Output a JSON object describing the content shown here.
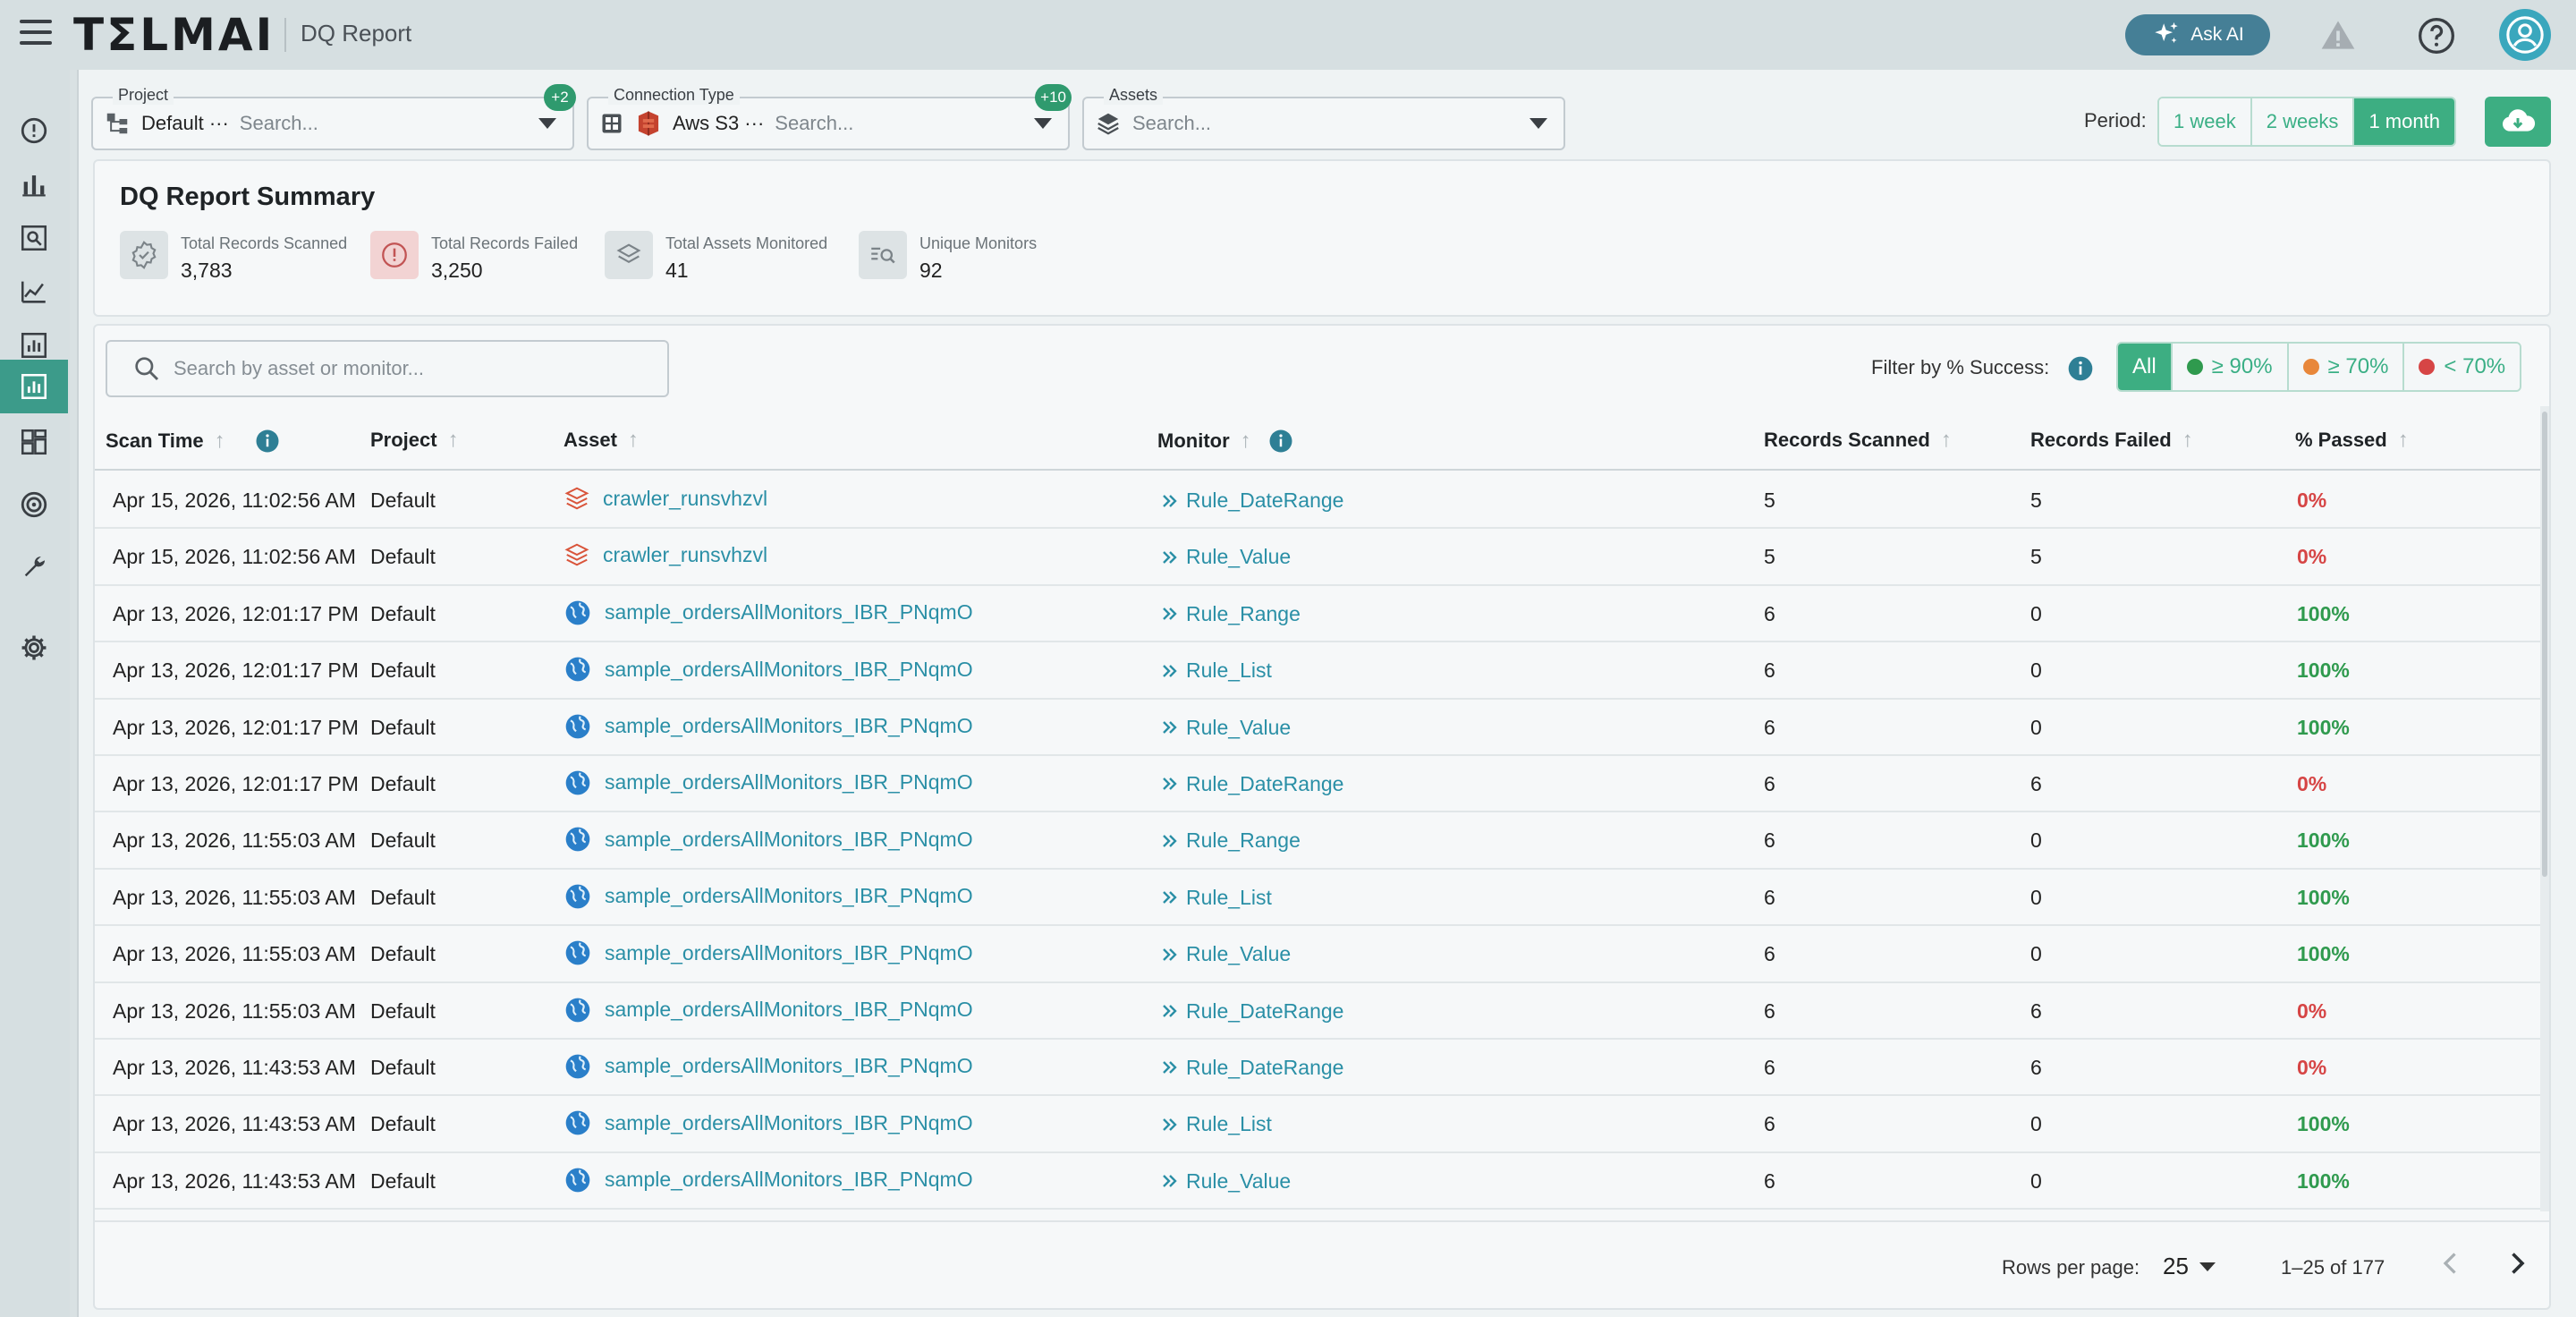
{
  "app": {
    "logo": "TΣLMAI",
    "page_title": "DQ Report"
  },
  "header": {
    "ask_ai_label": "Ask AI",
    "icons": [
      "menu-icon",
      "sparkle-icon",
      "warning-icon",
      "help-icon",
      "user-icon"
    ]
  },
  "sidebar": {
    "items": [
      {
        "icon": "alert-circle-icon"
      },
      {
        "icon": "bar-chart-icon"
      },
      {
        "icon": "report-search-icon"
      },
      {
        "icon": "line-chart-icon"
      },
      {
        "icon": "report-chart-icon"
      },
      {
        "icon": "dq-report-icon",
        "active": true
      },
      {
        "icon": "dashboard-grid-icon"
      },
      {
        "icon": "target-icon"
      },
      {
        "icon": "wrench-icon"
      },
      {
        "icon": "gear-icon"
      }
    ]
  },
  "filters": {
    "project": {
      "label": "Project",
      "value": "Default ···",
      "placeholder": "Search...",
      "badge": "+2"
    },
    "connection": {
      "label": "Connection Type",
      "value": "Aws S3 ···",
      "placeholder": "Search...",
      "badge": "+10"
    },
    "assets": {
      "label": "Assets",
      "placeholder": "Search..."
    },
    "period_label": "Period:",
    "period_options": [
      "1 week",
      "2 weeks",
      "1 month"
    ],
    "period_selected": "1 month"
  },
  "summary": {
    "title": "DQ Report Summary",
    "stats": [
      {
        "label": "Total Records Scanned",
        "value": "3,783",
        "icon": "check-badge-icon"
      },
      {
        "label": "Total Records Failed",
        "value": "3,250",
        "icon": "alert-circle-icon"
      },
      {
        "label": "Total Assets Monitored",
        "value": "41",
        "icon": "layers-icon"
      },
      {
        "label": "Unique Monitors",
        "value": "92",
        "icon": "monitor-search-icon"
      }
    ]
  },
  "table": {
    "search_placeholder": "Search by asset or monitor...",
    "filter_label": "Filter by % Success:",
    "filter_options": [
      {
        "label": "All",
        "active": true
      },
      {
        "label": "≥ 90%",
        "dot": "#2f9a4e"
      },
      {
        "label": "≥ 70%",
        "dot": "#e8873a"
      },
      {
        "label": "< 70%",
        "dot": "#d64545"
      }
    ],
    "columns": [
      "Scan Time",
      "Project",
      "Asset",
      "Monitor",
      "Records Scanned",
      "Records Failed",
      "% Passed"
    ],
    "rows": [
      {
        "scan_time": "Apr 15, 2026, 11:02:56 AM",
        "project": "Default",
        "asset": "crawler_runsvhzvl",
        "asset_type": "s3",
        "monitor": "Rule_DateRange",
        "scanned": "5",
        "failed": "5",
        "passed": "0%"
      },
      {
        "scan_time": "Apr 15, 2026, 11:02:56 AM",
        "project": "Default",
        "asset": "crawler_runsvhzvl",
        "asset_type": "s3",
        "monitor": "Rule_Value",
        "scanned": "5",
        "failed": "5",
        "passed": "0%"
      },
      {
        "scan_time": "Apr 13, 2026, 12:01:17 PM",
        "project": "Default",
        "asset": "sample_ordersAllMonitors_IBR_PNqmO",
        "asset_type": "globe",
        "monitor": "Rule_Range",
        "scanned": "6",
        "failed": "0",
        "passed": "100%"
      },
      {
        "scan_time": "Apr 13, 2026, 12:01:17 PM",
        "project": "Default",
        "asset": "sample_ordersAllMonitors_IBR_PNqmO",
        "asset_type": "globe",
        "monitor": "Rule_List",
        "scanned": "6",
        "failed": "0",
        "passed": "100%"
      },
      {
        "scan_time": "Apr 13, 2026, 12:01:17 PM",
        "project": "Default",
        "asset": "sample_ordersAllMonitors_IBR_PNqmO",
        "asset_type": "globe",
        "monitor": "Rule_Value",
        "scanned": "6",
        "failed": "0",
        "passed": "100%"
      },
      {
        "scan_time": "Apr 13, 2026, 12:01:17 PM",
        "project": "Default",
        "asset": "sample_ordersAllMonitors_IBR_PNqmO",
        "asset_type": "globe",
        "monitor": "Rule_DateRange",
        "scanned": "6",
        "failed": "6",
        "passed": "0%"
      },
      {
        "scan_time": "Apr 13, 2026, 11:55:03 AM",
        "project": "Default",
        "asset": "sample_ordersAllMonitors_IBR_PNqmO",
        "asset_type": "globe",
        "monitor": "Rule_Range",
        "scanned": "6",
        "failed": "0",
        "passed": "100%"
      },
      {
        "scan_time": "Apr 13, 2026, 11:55:03 AM",
        "project": "Default",
        "asset": "sample_ordersAllMonitors_IBR_PNqmO",
        "asset_type": "globe",
        "monitor": "Rule_List",
        "scanned": "6",
        "failed": "0",
        "passed": "100%"
      },
      {
        "scan_time": "Apr 13, 2026, 11:55:03 AM",
        "project": "Default",
        "asset": "sample_ordersAllMonitors_IBR_PNqmO",
        "asset_type": "globe",
        "monitor": "Rule_Value",
        "scanned": "6",
        "failed": "0",
        "passed": "100%"
      },
      {
        "scan_time": "Apr 13, 2026, 11:55:03 AM",
        "project": "Default",
        "asset": "sample_ordersAllMonitors_IBR_PNqmO",
        "asset_type": "globe",
        "monitor": "Rule_DateRange",
        "scanned": "6",
        "failed": "6",
        "passed": "0%"
      },
      {
        "scan_time": "Apr 13, 2026, 11:43:53 AM",
        "project": "Default",
        "asset": "sample_ordersAllMonitors_IBR_PNqmO",
        "asset_type": "globe",
        "monitor": "Rule_DateRange",
        "scanned": "6",
        "failed": "6",
        "passed": "0%"
      },
      {
        "scan_time": "Apr 13, 2026, 11:43:53 AM",
        "project": "Default",
        "asset": "sample_ordersAllMonitors_IBR_PNqmO",
        "asset_type": "globe",
        "monitor": "Rule_List",
        "scanned": "6",
        "failed": "0",
        "passed": "100%"
      },
      {
        "scan_time": "Apr 13, 2026, 11:43:53 AM",
        "project": "Default",
        "asset": "sample_ordersAllMonitors_IBR_PNqmO",
        "asset_type": "globe",
        "monitor": "Rule_Value",
        "scanned": "6",
        "failed": "0",
        "passed": "100%"
      }
    ],
    "pagination": {
      "rows_per_page_label": "Rows per page:",
      "rows_per_page": "25",
      "range": "1–25 of 177"
    }
  },
  "colors": {
    "accent": "#3dae82",
    "link": "#2a8fa6",
    "fail": "#d64545",
    "pass": "#2f9a4e",
    "active_nav": "#3c9b8a"
  }
}
